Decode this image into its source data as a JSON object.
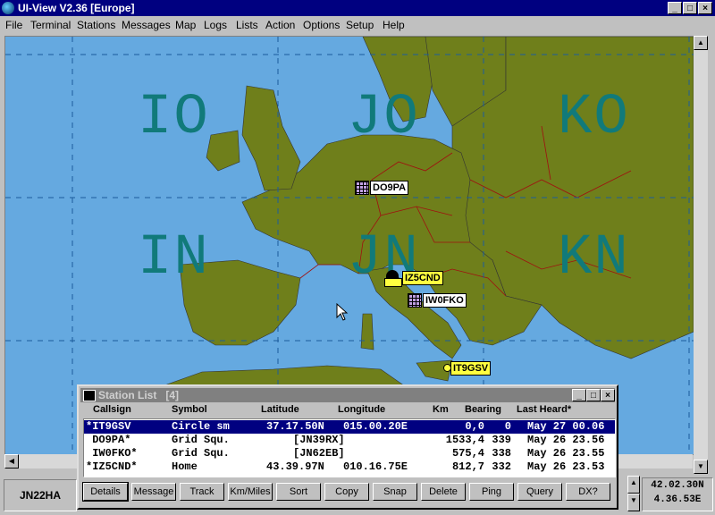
{
  "window": {
    "title": "UI-View V2.36 [Europe]"
  },
  "menu": [
    "File",
    "Terminal",
    "Stations",
    "Messages",
    "Map",
    "Logs",
    "Lists",
    "Action",
    "Options",
    "Setup",
    "Help"
  ],
  "map": {
    "grid_squares": [
      "IO",
      "JO",
      "KO",
      "IN",
      "JN",
      "KN"
    ],
    "stations": [
      "DO9PA",
      "IZ5CND",
      "IW0FKO",
      "IT9GSV"
    ]
  },
  "status": {
    "locator": "JN22HA",
    "lat": "42.02.30N",
    "lon": "4.36.53E"
  },
  "station_list": {
    "title": "Station List",
    "count": "[4]",
    "columns": [
      "Callsign",
      "Symbol",
      "Latitude",
      "Longitude",
      "Km",
      "Bearing",
      "Last Heard*"
    ],
    "rows": [
      {
        "callsign": "*IT9GSV",
        "symbol": "Circle sm",
        "latitude": "37.17.50N",
        "longitude": "015.00.20E",
        "km": "0,0",
        "bearing": "0",
        "heard": "May 27 00.06"
      },
      {
        "callsign": " DO9PA*",
        "symbol": "Grid Squ.",
        "latitude": "[JN39RX]",
        "longitude": "",
        "km": "1533,4",
        "bearing": "339",
        "heard": "May 26 23.56"
      },
      {
        "callsign": " IW0FKO*",
        "symbol": "Grid Squ.",
        "latitude": "[JN62EB]",
        "longitude": "",
        "km": "575,4",
        "bearing": "338",
        "heard": "May 26 23.55"
      },
      {
        "callsign": "*IZ5CND*",
        "symbol": "Home",
        "latitude": "43.39.97N",
        "longitude": "010.16.75E",
        "km": "812,7",
        "bearing": "332",
        "heard": "May 26 23.53"
      }
    ],
    "buttons": [
      "Details",
      "Message",
      "Track",
      "Km/Miles",
      "Sort",
      "Copy",
      "Snap",
      "Delete",
      "Ping",
      "Query",
      "DX?"
    ]
  },
  "colors": {
    "sea": "#65a9e0",
    "land": "#6f7f1b",
    "grid_text": "#117a7a",
    "border": "#a01010"
  }
}
